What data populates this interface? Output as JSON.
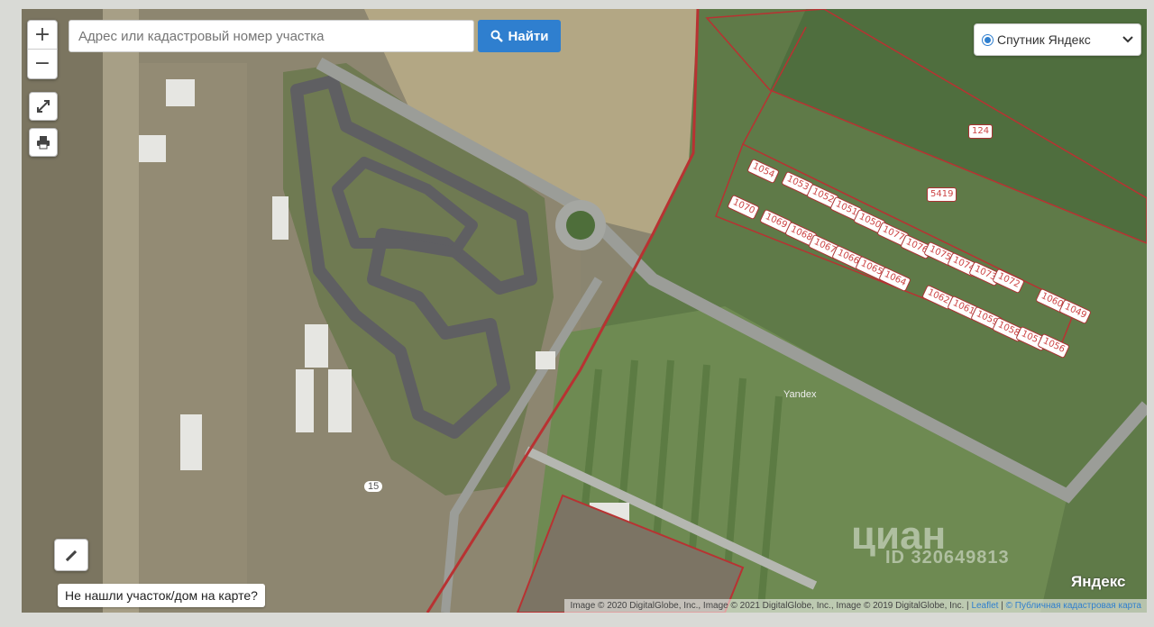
{
  "search": {
    "placeholder": "Адрес или кадастровый номер участка",
    "button_label": "Найти"
  },
  "zoom": {
    "in_label": "+",
    "out_label": "−"
  },
  "layer_select": {
    "selected": "Спутник Яндекс"
  },
  "not_found_label": "Не нашли участок/дом на карте?",
  "plots": [
    "124",
    "5419",
    "1054",
    "1053",
    "1052",
    "1051",
    "1050",
    "1077",
    "1076",
    "1075",
    "1074",
    "1073",
    "1072",
    "1070",
    "1069",
    "1068",
    "1067",
    "1066",
    "1065",
    "1064",
    "1062",
    "1061",
    "1059",
    "1058",
    "1057",
    "1056",
    "1060",
    "1049"
  ],
  "road_number": "15",
  "yandex_map_label": "Yandex",
  "yandex_logo": "Яндекс",
  "watermark": {
    "brand": "циан",
    "id": "ID 320649813"
  },
  "attribution": {
    "imagery": "Image © 2020 DigitalGlobe, Inc., Image © 2021 DigitalGlobe, Inc., Image © 2019 DigitalGlobe, Inc.",
    "leaflet": "Leaflet",
    "cadastral": "© Публичная кадастровая карта"
  },
  "colors": {
    "accent": "#2f7fcf",
    "plot_border": "#b83232"
  }
}
